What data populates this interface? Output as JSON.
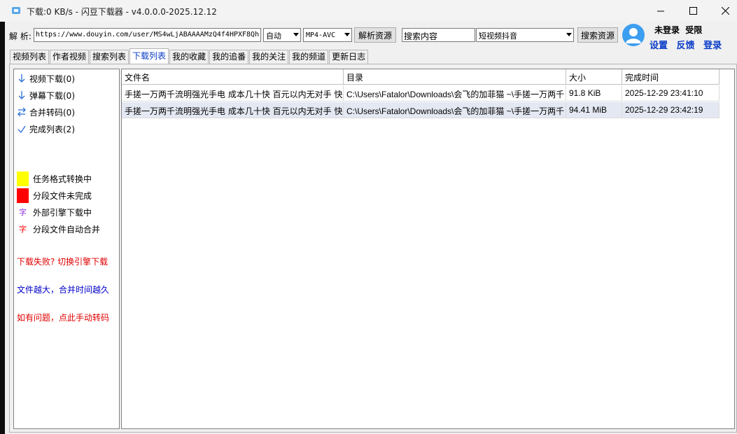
{
  "window": {
    "title": "下载:0 KB/s - 闪豆下载器 - v4.0.0.0-2025.12.12"
  },
  "toolbar": {
    "parse_label": "解 析:",
    "url_value": "https://www.douyin.com/user/MS4wLjABAAAAMzQ4f4HPXF8Qh",
    "mode_select": "自动",
    "format_select": "MP4-AVC",
    "parse_button": "解析资源",
    "search_value": "搜索内容",
    "platform_select": "短视频抖音",
    "search_button": "搜索资源"
  },
  "user": {
    "status": "未登录",
    "tier": "受限",
    "settings_link": "设置",
    "feedback_link": "反馈",
    "login_link": "登录"
  },
  "tabs": [
    {
      "label": "视频列表"
    },
    {
      "label": "作者视频"
    },
    {
      "label": "搜索列表"
    },
    {
      "label": "下载列表",
      "active": true
    },
    {
      "label": "我的收藏"
    },
    {
      "label": "我的追番"
    },
    {
      "label": "我的关注"
    },
    {
      "label": "我的频道"
    },
    {
      "label": "更新日志"
    }
  ],
  "sidebar": {
    "items": [
      {
        "label": "视频下载(0)",
        "icon": "arrow-down-icon"
      },
      {
        "label": "弹幕下载(0)",
        "icon": "arrow-down-icon"
      },
      {
        "label": "合并转码(0)",
        "icon": "swap-icon"
      },
      {
        "label": "完成列表(2)",
        "icon": "check-icon"
      }
    ],
    "legend": [
      {
        "label": "任务格式转换中",
        "color": "#ffff00"
      },
      {
        "label": "分段文件未完成",
        "color": "#ff0000"
      },
      {
        "label": "外部引擎下载中",
        "char": "字",
        "color": "#8a2be2"
      },
      {
        "label": "分段文件自动合并",
        "char": "字",
        "color": "#ff0000"
      }
    ],
    "notes": [
      {
        "text": "下载失败? 切换引擎下载",
        "color": "#e00000"
      },
      {
        "text": "文件越大，合并时间越久",
        "color": "#0000c8"
      },
      {
        "text": "如有问题，点此手动转码",
        "color": "#e00000"
      }
    ]
  },
  "table": {
    "columns": [
      "文件名",
      "目录",
      "大小",
      "完成时间"
    ],
    "rows": [
      {
        "name": "手搓一万两千流明强光手电 成本几十快 百元以内无对手 快",
        "dir": "C:\\Users\\Fatalor\\Downloads\\会飞的加菲猫 ~\\手搓一万两千",
        "size": "91.8 KiB",
        "time": "2025-12-29 23:41:10"
      },
      {
        "name": "手搓一万两千流明强光手电 成本几十快 百元以内无对手 快",
        "dir": "C:\\Users\\Fatalor\\Downloads\\会飞的加菲猫 ~\\手搓一万两千",
        "size": "94.41 MiB",
        "time": "2025-12-29 23:42:19",
        "selected": true
      }
    ]
  },
  "colors": {
    "accent": "#0a3cc8",
    "icon_blue": "#2b6fd6",
    "avatar": "#3c9ef0"
  }
}
